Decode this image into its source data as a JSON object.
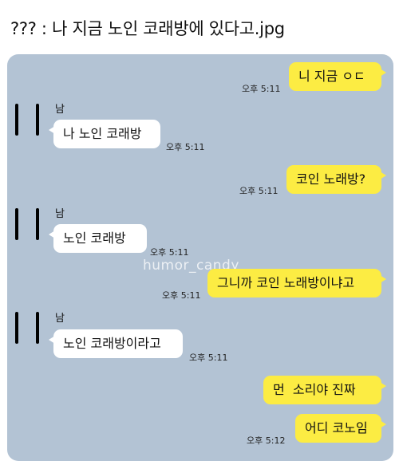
{
  "caption": "??? : 나 지금 노인 코래방에 있다고.jpg",
  "watermark": "humor_candy__",
  "messages": [
    {
      "side": "me",
      "text": "니 지금 ㅇㄷ",
      "time": "오후 5:11"
    },
    {
      "side": "them",
      "sender": "남",
      "text": "나 노인 코래방",
      "time": "오후 5:11"
    },
    {
      "side": "me",
      "text": "코인 노래방?",
      "time": "오후 5:11"
    },
    {
      "side": "them",
      "sender": "남",
      "text": "노인 코래방",
      "time": "오후 5:11"
    },
    {
      "side": "me",
      "text": "그니까 코인 노래방이냐고",
      "time": "오후 5:11"
    },
    {
      "side": "them",
      "sender": "남",
      "text": "노인 코래방이라고",
      "time": "오후 5:11"
    },
    {
      "side": "me",
      "text": "먼  소리야 진짜",
      "time": ""
    },
    {
      "side": "me",
      "text": "어디 코노임",
      "time": "오후 5:12"
    }
  ]
}
